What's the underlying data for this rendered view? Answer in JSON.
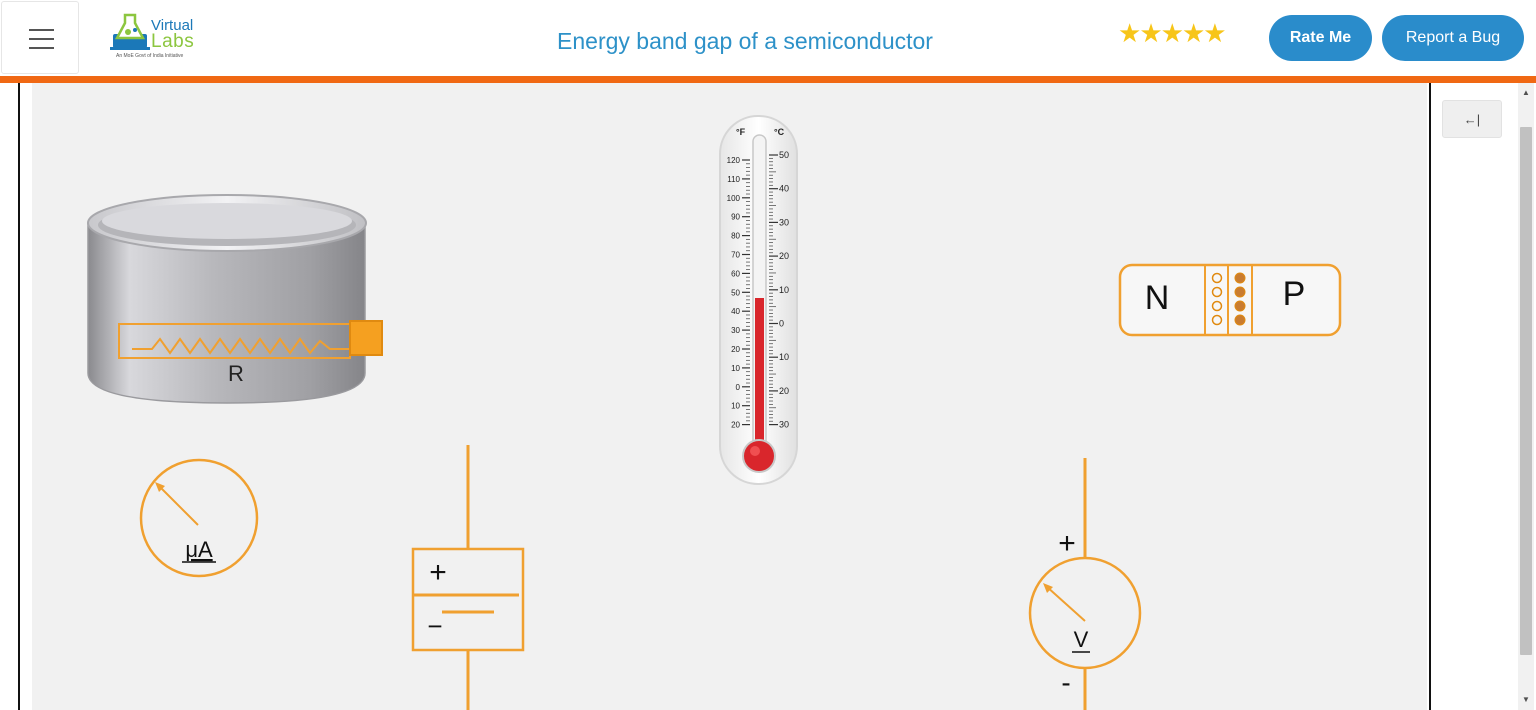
{
  "header": {
    "logo_title": "Virtual",
    "logo_subtitle": "Labs",
    "logo_tagline": "An MoE Govt of India Initiative",
    "page_title": "Energy band gap of a semiconductor",
    "rating_stars": 5,
    "rate_button": "Rate Me",
    "bug_button": "Report a Bug"
  },
  "side_panel": {
    "collapse_label": "←|"
  },
  "apparatus": {
    "heater_label": "R",
    "ammeter_label": "μA",
    "voltmeter_label": "V",
    "battery_plus": "+",
    "battery_minus": "−",
    "volt_plus": "+",
    "volt_minus": "-",
    "diode_n": "N",
    "diode_p": "P",
    "thermometer": {
      "unit_f": "°F",
      "unit_c": "°C",
      "f_ticks": [
        "120",
        "110",
        "100",
        "90",
        "80",
        "70",
        "60",
        "50",
        "40",
        "30",
        "20",
        "10",
        "0",
        "10",
        "20"
      ],
      "c_ticks": [
        "50",
        "40",
        "30",
        "20",
        "10",
        "0",
        "10",
        "20",
        "30"
      ],
      "mercury_level_c": 10
    }
  },
  "colors": {
    "accent_orange": "#f0a030",
    "header_bar": "#f06813",
    "button_blue": "#2a8ccb",
    "title_blue": "#2d91c8",
    "star_gold": "#f7c519",
    "mercury_red": "#d9262c"
  }
}
